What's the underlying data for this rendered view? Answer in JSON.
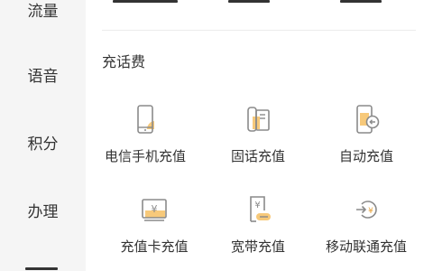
{
  "sidebar": {
    "items": [
      {
        "label": "流量"
      },
      {
        "label": "语音"
      },
      {
        "label": "积分"
      },
      {
        "label": "办理"
      }
    ]
  },
  "section": {
    "title": "充话费",
    "tiles": [
      {
        "label": "电信手机充值",
        "icon": "mobile-phone-icon"
      },
      {
        "label": "固话充值",
        "icon": "landline-phone-icon"
      },
      {
        "label": "自动充值",
        "icon": "auto-recharge-icon"
      },
      {
        "label": "充值卡充值",
        "icon": "recharge-card-icon"
      },
      {
        "label": "宽带充值",
        "icon": "broadband-recharge-icon"
      },
      {
        "label": "移动联通充值",
        "icon": "other-carrier-recharge-icon"
      }
    ]
  },
  "colors": {
    "sidebar_bg": "#f5f5f5",
    "text": "#333333",
    "icon_line": "#8a8a8a",
    "icon_accent": "#f7c97a"
  }
}
